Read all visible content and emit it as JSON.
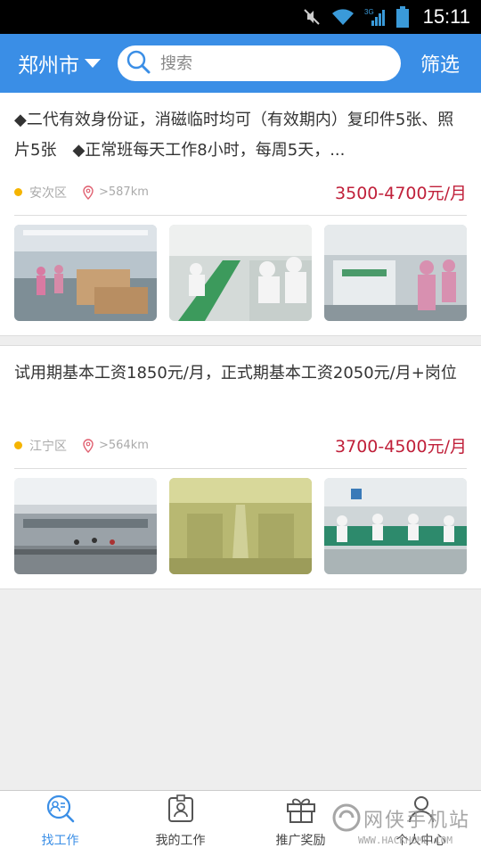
{
  "status_bar": {
    "time": "15:11",
    "network": "3G"
  },
  "header": {
    "city": "郑州市",
    "search_placeholder": "搜索",
    "filter_label": "筛选"
  },
  "jobs": [
    {
      "description": "◆二代有效身份证，消磁临时均可（有效期内）复印件5张、照片5张　◆正常班每天工作8小时，每周5天，...",
      "district": "安次区",
      "distance": ">587km",
      "salary": "3500-4700元/月",
      "photos": [
        "factory-floor-boxes",
        "assembly-line-workers",
        "production-line-machines"
      ]
    },
    {
      "description": "试用期基本工资1850元/月，正式期基本工资2050元/月+岗位",
      "district": "江宁区",
      "distance": ">564km",
      "salary": "3700-4500元/月",
      "photos": [
        "factory-building-exterior",
        "workshop-interior",
        "assembly-line-workers"
      ]
    }
  ],
  "bottom_nav": [
    {
      "label": "找工作",
      "icon": "search-job-icon",
      "active": true
    },
    {
      "label": "我的工作",
      "icon": "badge-icon",
      "active": false
    },
    {
      "label": "推广奖励",
      "icon": "gift-icon",
      "active": false
    },
    {
      "label": "个人中心",
      "icon": "person-icon",
      "active": false
    }
  ],
  "watermark": {
    "text": "网侠手机站",
    "url": "WWW.HACKHOME.COM"
  },
  "colors": {
    "header": "#3a8ee6",
    "salary": "#c0203a",
    "district_dot": "#f5b400"
  }
}
